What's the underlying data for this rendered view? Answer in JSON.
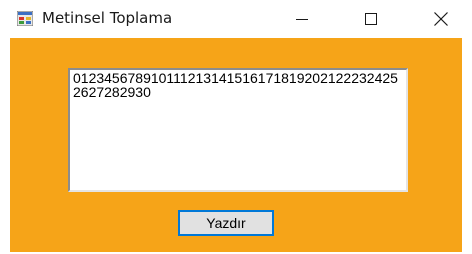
{
  "window": {
    "title": "Metinsel Toplama",
    "icon": "windows-form-icon",
    "background_color": "#f6a418"
  },
  "caption_buttons": {
    "minimize_icon": "minimize-icon",
    "maximize_icon": "maximize-icon",
    "close_icon": "close-icon"
  },
  "textbox": {
    "value": "0123456789101112131415161718192021222324252627282930"
  },
  "button": {
    "label": "Yazdır"
  }
}
